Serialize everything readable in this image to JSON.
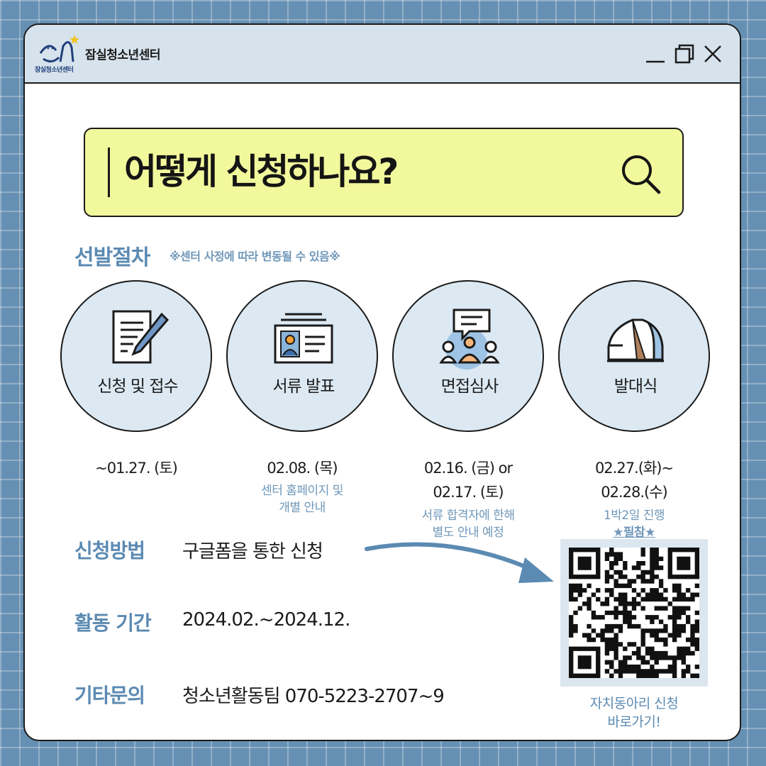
{
  "window": {
    "app_title": "잠실청소년센터",
    "logo_text": "잠실청소년센터"
  },
  "search": {
    "query": "어떻게 신청하나요?"
  },
  "selection": {
    "title": "선발절차",
    "note": "※센터 사정에 따라 변동될 수 있음※",
    "steps": [
      {
        "icon": "document-pen-icon",
        "label": "신청 및 접수",
        "date_lines": [
          "~01.27. (토)"
        ],
        "note_lines": []
      },
      {
        "icon": "id-card-icon",
        "label": "서류 발표",
        "date_lines": [
          "02.08. (목)"
        ],
        "note_lines": [
          "센터 홈페이지 및",
          "개별 안내"
        ]
      },
      {
        "icon": "interview-meeting-icon",
        "label": "면접심사",
        "date_lines": [
          "02.16. (금) or",
          "02.17. (토)"
        ],
        "note_lines": [
          "서류 합격자에 한해",
          "별도 안내 예정"
        ]
      },
      {
        "icon": "tent-icon",
        "label": "발대식",
        "date_lines": [
          "02.27.(화)~",
          "02.28.(수)"
        ],
        "note_lines": [
          "1박2일 진행",
          "★필참★"
        ]
      }
    ]
  },
  "info": {
    "method_label": "신청방법",
    "method_value": "구글폼을 통한 신청",
    "period_label": "활동 기간",
    "period_value": "2024.02.~2024.12.",
    "contact_label": "기타문의",
    "contact_value": "청소년활동팀 070-5223-2707~9"
  },
  "qr": {
    "caption_line1": "자치동아리 신청",
    "caption_line2": "바로가기!"
  },
  "colors": {
    "accent_blue": "#5b8ab2",
    "search_yellow": "#f2f89c",
    "circle_fill": "#dce9f3",
    "background": "#6690b3"
  }
}
